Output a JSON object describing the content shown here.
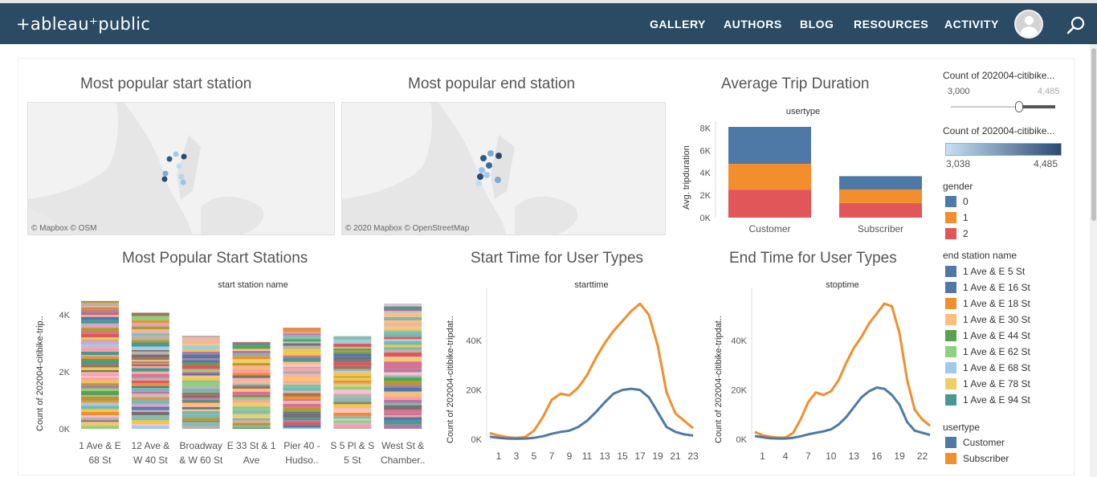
{
  "nav": {
    "logo": "+ableau⁺public",
    "items": [
      "GALLERY",
      "AUTHORS",
      "BLOG",
      "RESOURCES",
      "ACTIVITY"
    ]
  },
  "colors": {
    "nav_bg": "#2b4a63",
    "blue": "#4e79a7",
    "orange": "#f28e2b",
    "red": "#e15759"
  },
  "maps": {
    "start": {
      "title": "Most popular start station",
      "credit": "© Mapbox  © OSM"
    },
    "end": {
      "title": "Most popular end station",
      "credit": "© 2020 Mapbox  © OpenStreetMap"
    }
  },
  "trip_duration": {
    "title": "Average Trip Duration"
  },
  "start_stations": {
    "title": "Most Popular Start Stations"
  },
  "start_time": {
    "title": "Start Time for User Types"
  },
  "end_time": {
    "title": "End Time for User Types"
  },
  "legends": {
    "slider": {
      "title": "Count of 202004-citibike...",
      "min": "3,000",
      "max": "4,485",
      "value": 4485
    },
    "gradient": {
      "title": "Count of 202004-citibike...",
      "min": "3,038",
      "max": "4,485"
    },
    "gender": {
      "title": "gender",
      "items": [
        {
          "label": "0",
          "color": "#4e79a7"
        },
        {
          "label": "1",
          "color": "#f28e2b"
        },
        {
          "label": "2",
          "color": "#e15759"
        }
      ]
    },
    "station": {
      "title": "end station name",
      "items": [
        {
          "label": "1 Ave & E 5 St",
          "color": "#4e79a7"
        },
        {
          "label": "1 Ave & E 16 St",
          "color": "#4e79a7"
        },
        {
          "label": "1 Ave & E 18 St",
          "color": "#f28e2b"
        },
        {
          "label": "1 Ave & E 30 St",
          "color": "#ffbe7d"
        },
        {
          "label": "1 Ave & E 44 St",
          "color": "#59a14f"
        },
        {
          "label": "1 Ave & E 62 St",
          "color": "#8cd17d"
        },
        {
          "label": "1 Ave & E 68 St",
          "color": "#a0cbe8"
        },
        {
          "label": "1 Ave & E 78 St",
          "color": "#f1ce63"
        },
        {
          "label": "1 Ave & E 94 St",
          "color": "#499894"
        }
      ]
    },
    "usertype": {
      "title": "usertype",
      "items": [
        {
          "label": "Customer",
          "color": "#4e79a7"
        },
        {
          "label": "Subscriber",
          "color": "#f28e2b"
        }
      ]
    }
  },
  "chart_data": [
    {
      "id": "avg_trip_duration",
      "type": "bar",
      "title": "Average Trip Duration",
      "header": "usertype",
      "ylabel": "Avg. tripduration",
      "categories": [
        "Customer",
        "Subscriber"
      ],
      "stacked": true,
      "series": [
        {
          "name": "0",
          "color": "#4e79a7",
          "values": [
            3300,
            1200
          ]
        },
        {
          "name": "1",
          "color": "#f28e2b",
          "values": [
            2300,
            1200
          ]
        },
        {
          "name": "2",
          "color": "#e15759",
          "values": [
            2500,
            1300
          ]
        }
      ],
      "yticks": [
        "0K",
        "2K",
        "4K",
        "6K",
        "8K"
      ],
      "ylim": [
        0,
        8600
      ]
    },
    {
      "id": "popular_start_stations",
      "type": "bar",
      "title": "Most Popular Start Stations",
      "header": "start station name",
      "ylabel": "Count of 202004-citibike-trip..",
      "stacked": true,
      "categories": [
        "1 Ave & E 68 St",
        "12 Ave & W 40 St",
        "Broadway & W 60 St",
        "E 33 St & 1 Ave",
        "Pier 40 - Hudso..",
        "S 5 Pl & S 5 St",
        "West St & Chamber.."
      ],
      "category_lines": [
        [
          "1 Ave & E",
          "68 St"
        ],
        [
          "12 Ave &",
          "W 40 St"
        ],
        [
          "Broadway",
          "& W 60 St"
        ],
        [
          "E 33 St & 1",
          "Ave"
        ],
        [
          "Pier 40 -",
          "Hudso.."
        ],
        [
          "S 5 Pl & S",
          "5 St"
        ],
        [
          "West St &",
          "Chamber.."
        ]
      ],
      "values": [
        4485,
        4080,
        3270,
        3050,
        3550,
        3250,
        4380
      ],
      "yticks": [
        "0K",
        "2K",
        "4K"
      ],
      "ylim": [
        0,
        4650
      ]
    },
    {
      "id": "start_time",
      "type": "line",
      "title": "Start Time for User Types",
      "header": "starttime",
      "ylabel": "Count of 202004-citibike-tripdat..",
      "x": [
        0,
        1,
        2,
        3,
        4,
        5,
        6,
        7,
        8,
        9,
        10,
        11,
        12,
        13,
        14,
        15,
        16,
        17,
        18,
        19,
        20,
        21,
        22,
        23
      ],
      "xticks": [
        1,
        3,
        5,
        7,
        9,
        11,
        13,
        15,
        17,
        19,
        21,
        23
      ],
      "series": [
        {
          "name": "Subscriber",
          "color": "#f28e2b",
          "values": [
            2500,
            1500,
            800,
            600,
            900,
            3500,
            9000,
            16000,
            18500,
            17800,
            21000,
            26000,
            33000,
            39000,
            44000,
            48000,
            52000,
            55000,
            50500,
            38000,
            19000,
            10500,
            7500,
            4500
          ]
        },
        {
          "name": "Customer",
          "color": "#4e79a7",
          "values": [
            1000,
            600,
            300,
            200,
            300,
            600,
            1200,
            2200,
            3000,
            3500,
            5000,
            7500,
            11000,
            15000,
            18500,
            20000,
            20500,
            20000,
            17000,
            11000,
            5000,
            3000,
            2000,
            1500
          ]
        }
      ],
      "yticks": [
        "0K",
        "20K",
        "40K"
      ],
      "ylim": [
        0,
        58000
      ]
    },
    {
      "id": "end_time",
      "type": "line",
      "title": "End Time for User Types",
      "header": "stoptime",
      "ylabel": "Count of 202004-citibike-tripdat..",
      "x": [
        0,
        1,
        2,
        3,
        4,
        5,
        6,
        7,
        8,
        9,
        10,
        11,
        12,
        13,
        14,
        15,
        16,
        17,
        18,
        19,
        20,
        21,
        22,
        23
      ],
      "xticks": [
        1,
        4,
        7,
        10,
        13,
        16,
        19,
        22
      ],
      "series": [
        {
          "name": "Subscriber",
          "color": "#f28e2b",
          "values": [
            3000,
            1600,
            1000,
            700,
            700,
            2500,
            8000,
            15000,
            19000,
            18000,
            19500,
            24000,
            31000,
            37000,
            41500,
            47000,
            51000,
            55000,
            54000,
            43000,
            24000,
            12000,
            8000,
            5500
          ]
        },
        {
          "name": "Customer",
          "color": "#4e79a7",
          "values": [
            1300,
            800,
            400,
            300,
            300,
            600,
            1200,
            2000,
            2600,
            3200,
            4000,
            6000,
            9000,
            13000,
            17000,
            19500,
            21000,
            20500,
            18000,
            14000,
            7000,
            3500,
            2600,
            1800
          ]
        }
      ],
      "yticks": [
        "0K",
        "20K",
        "40K"
      ],
      "ylim": [
        0,
        58000
      ]
    }
  ]
}
